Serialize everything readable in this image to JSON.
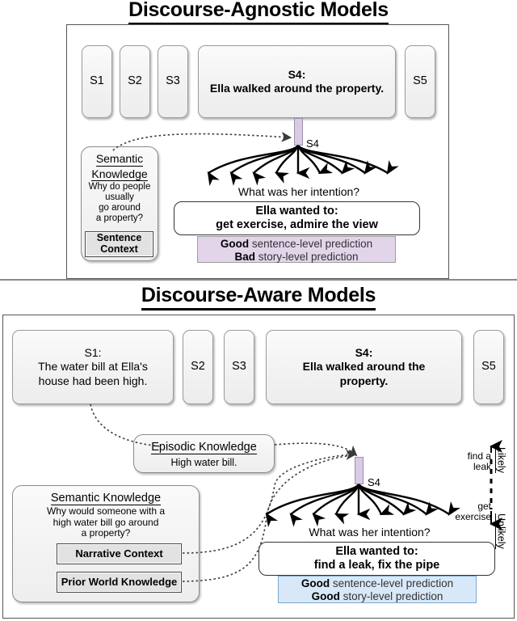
{
  "sections": {
    "top": {
      "title": "Discourse-Agnostic Models",
      "sentences": [
        {
          "id": "S1",
          "label": "S1",
          "text": ""
        },
        {
          "id": "S2",
          "label": "S2",
          "text": ""
        },
        {
          "id": "S3",
          "label": "S3",
          "text": ""
        },
        {
          "id": "S4",
          "label": "S4:",
          "text": "Ella walked around the property."
        },
        {
          "id": "S5",
          "label": "S5",
          "text": ""
        }
      ],
      "node_label": "S4",
      "knowledge": {
        "heading_line1": "Semantic",
        "heading_line2": "Knowledge",
        "body_line1": "Why do people",
        "body_line2": "usually",
        "body_line3": "go around",
        "body_line4": "a property?",
        "sub_line1": "Sentence",
        "sub_line2": "Context"
      },
      "question": "What was her intention?",
      "answer_line1": "Ella wanted to:",
      "answer_line2": "get exercise, admire the view",
      "prediction": {
        "line1_verdict": "Good",
        "line1_rest": " sentence-level prediction",
        "line2_verdict": "Bad",
        "line2_rest": " story-level prediction",
        "fill": "#e2d5ea"
      }
    },
    "bottom": {
      "title": "Discourse-Aware Models",
      "sentences": [
        {
          "id": "S1",
          "label": "S1:",
          "text_line1": "The water bill at Ella's",
          "text_line2": "house had been high."
        },
        {
          "id": "S2",
          "label": "S2",
          "text": ""
        },
        {
          "id": "S3",
          "label": "S3",
          "text": ""
        },
        {
          "id": "S4",
          "label": "S4:",
          "text_line1": "Ella walked around the",
          "text_line2": "property."
        },
        {
          "id": "S5",
          "label": "S5",
          "text": ""
        }
      ],
      "node_label": "S4",
      "episodic": {
        "heading": "Episodic Knowledge",
        "body": "High water bill."
      },
      "semantic": {
        "heading": "Semantic Knowledge",
        "body_line1": "Why would someone with a",
        "body_line2": "high water bill go around",
        "body_line3": "a property?",
        "sub1": "Narrative Context",
        "sub2": "Prior World Knowledge"
      },
      "question": "What was her intention?",
      "answer_line1": "Ella wanted to:",
      "answer_line2": "find a leak, fix the pipe",
      "prediction": {
        "line1_verdict": "Good",
        "line1_rest": " sentence-level prediction",
        "line2_verdict": "Good",
        "line2_rest": " story-level prediction",
        "fill": "#d8e8f8"
      },
      "scale": {
        "top_label": "Likely",
        "bottom_label": "Unlikely",
        "top_item_line1": "find a",
        "top_item_line2": "leak",
        "bottom_item_line1": "get",
        "bottom_item_line2": "exercise"
      }
    }
  },
  "colors": {
    "node_bar": "#d9cbe4",
    "pred_bad_fill": "#e2d5ea",
    "pred_good_fill": "#d8e8f8",
    "panel_border": "#555555"
  }
}
